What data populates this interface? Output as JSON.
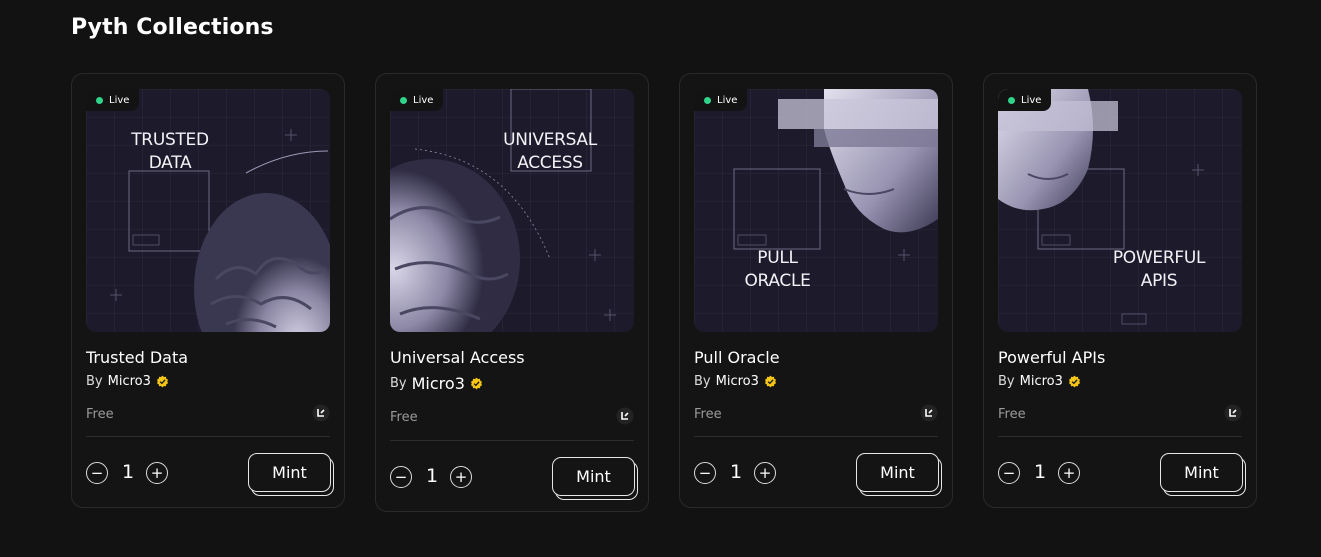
{
  "page": {
    "title": "Pyth Collections"
  },
  "colors": {
    "background": "#121212",
    "card": "#141414",
    "live": "#2fd38a",
    "verified": "#f5c518"
  },
  "cards": [
    {
      "badge": "Live",
      "art_line1": "TRUSTED",
      "art_line2": "DATA",
      "title": "Trusted Data",
      "by": "By",
      "creator": "Micro3",
      "price": "Free",
      "quantity": "1",
      "minus": "−",
      "plus": "+",
      "mint": "Mint"
    },
    {
      "badge": "Live",
      "art_line1": "UNIVERSAL",
      "art_line2": "ACCESS",
      "title": "Universal Access",
      "by": "By",
      "creator": "Micro3",
      "price": "Free",
      "quantity": "1",
      "minus": "−",
      "plus": "+",
      "mint": "Mint"
    },
    {
      "badge": "Live",
      "art_line1": "PULL",
      "art_line2": "ORACLE",
      "title": "Pull Oracle",
      "by": "By",
      "creator": "Micro3",
      "price": "Free",
      "quantity": "1",
      "minus": "−",
      "plus": "+",
      "mint": "Mint"
    },
    {
      "badge": "Live",
      "art_line1": "POWERFUL",
      "art_line2": "APIS",
      "title": "Powerful APIs",
      "by": "By",
      "creator": "Micro3",
      "price": "Free",
      "quantity": "1",
      "minus": "−",
      "plus": "+",
      "mint": "Mint"
    }
  ],
  "icons": {
    "verified": "verified-badge-icon",
    "chain": "chain-logo-icon"
  }
}
